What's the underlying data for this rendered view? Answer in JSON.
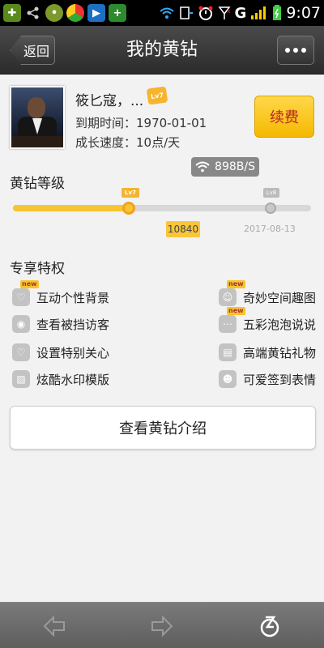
{
  "status_bar": {
    "time": "9:07",
    "network": "G",
    "icons": [
      "app-icon",
      "share-icon",
      "app-icon",
      "chrome-icon",
      "media-icon",
      "shield-plus-icon",
      "wifi-icon",
      "download-icon",
      "alarm-icon",
      "signal-icon",
      "battery-icon"
    ]
  },
  "header": {
    "back_label": "返回",
    "title": "我的黄钻"
  },
  "profile": {
    "name": "筱匕寇，...",
    "expire": "到期时间：1970-01-01",
    "growth": "成长速度：10点/天",
    "renew_label": "续费",
    "network_speed": "898B/S"
  },
  "level": {
    "title": "黄钻等级",
    "current_icon_text": "Lv7",
    "next_icon_text": "Lv8",
    "progress": 0.41,
    "score": "10840",
    "date": "2017-08-13"
  },
  "privileges": {
    "title": "专享特权",
    "items": [
      {
        "label": "互动个性背景",
        "icon": "heart-chat-icon",
        "is_new": true,
        "new_text": "new"
      },
      {
        "label": "奇妙空间趣图",
        "icon": "smiley-icon",
        "is_new": true,
        "new_text": "new"
      },
      {
        "label": "查看被挡访客",
        "icon": "eye-icon",
        "is_new": false,
        "new_text": ""
      },
      {
        "label": "五彩泡泡说说",
        "icon": "chat-bubble-icon",
        "is_new": true,
        "new_text": "new"
      },
      {
        "label": "设置特别关心",
        "icon": "heart-icon",
        "is_new": false,
        "new_text": ""
      },
      {
        "label": "高端黄钻礼物",
        "icon": "gift-icon",
        "is_new": false,
        "new_text": ""
      },
      {
        "label": "炫酷水印模版",
        "icon": "watermark-icon",
        "is_new": false,
        "new_text": ""
      },
      {
        "label": "可爱签到表情",
        "icon": "emoji-icon",
        "is_new": false,
        "new_text": ""
      }
    ]
  },
  "intro_button_label": "查看黄钻介绍",
  "colors": {
    "accent_yellow": "#f7c533",
    "title_bar": "#333333",
    "background": "#f2f2f2"
  }
}
